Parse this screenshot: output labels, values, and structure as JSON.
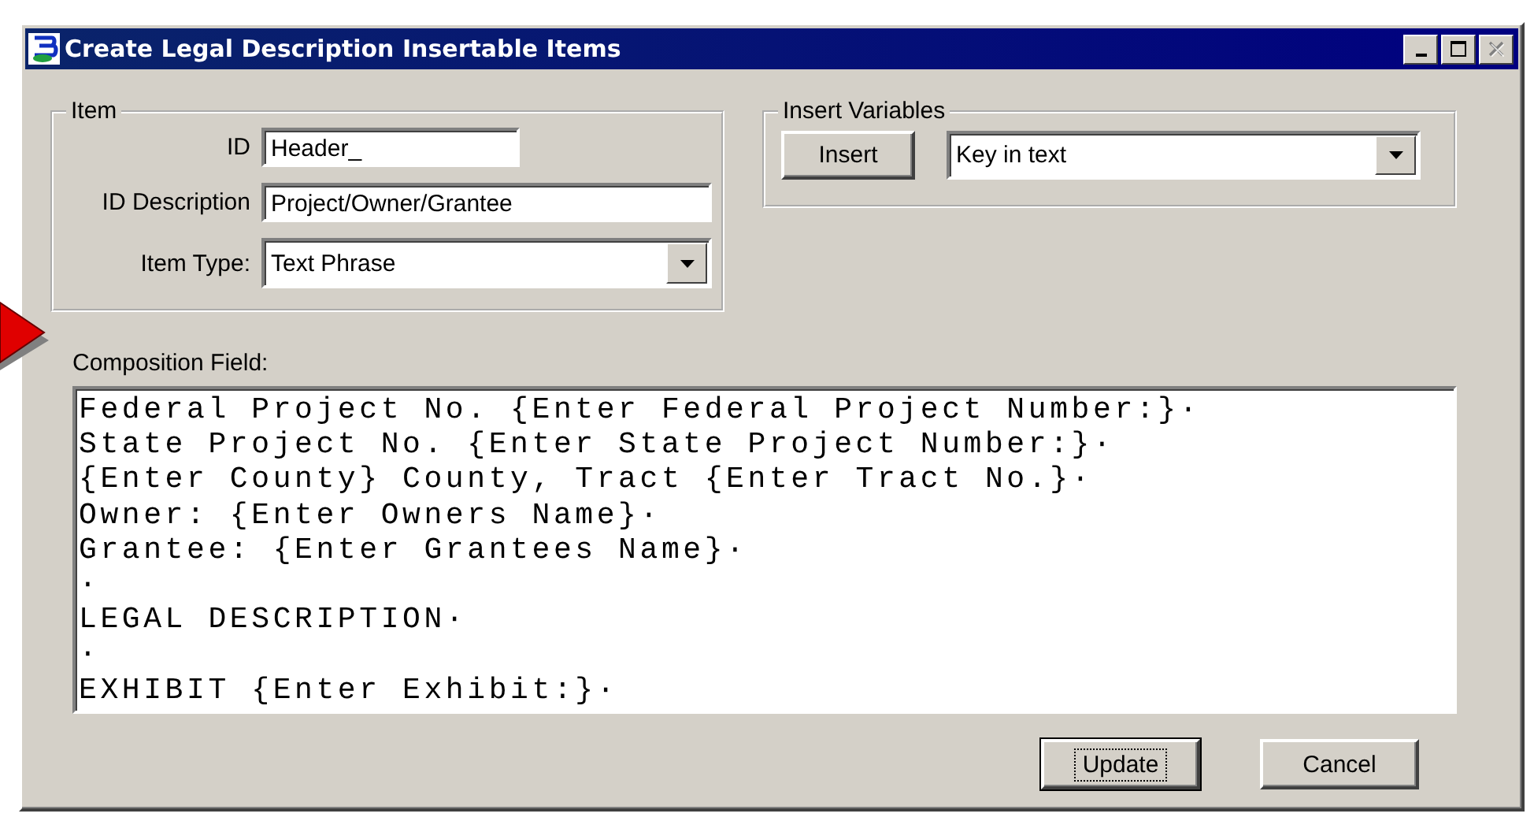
{
  "window": {
    "title": "Create Legal Description Insertable Items",
    "title_buttons": [
      {
        "kind": "minimize",
        "disabled": false
      },
      {
        "kind": "maximize",
        "disabled": false
      },
      {
        "kind": "close",
        "disabled": true
      }
    ]
  },
  "item_group": {
    "label": "Item",
    "id_label": "ID",
    "id_value": "Header_",
    "description_label": "ID Description",
    "description_value": "Project/Owner/Grantee",
    "type_label": "Item Type:",
    "type_value": "Text Phrase"
  },
  "insert_group": {
    "label": "Insert Variables",
    "button": "Insert",
    "variable_value": "Key in text"
  },
  "composition": {
    "label": "Composition Field:",
    "lines": [
      "Federal Project No. {Enter Federal Project Number:}·",
      "State Project No. {Enter State Project Number:}·",
      "{Enter County} County, Tract {Enter Tract No.}·",
      "Owner: {Enter Owners Name}·",
      "Grantee: {Enter Grantees Name}·",
      "·",
      "LEGAL DESCRIPTION·",
      "·",
      "EXHIBIT {Enter Exhibit:}·"
    ]
  },
  "buttons": [
    {
      "label": "Update",
      "focused": true
    },
    {
      "label": "Cancel",
      "focused": false
    }
  ]
}
